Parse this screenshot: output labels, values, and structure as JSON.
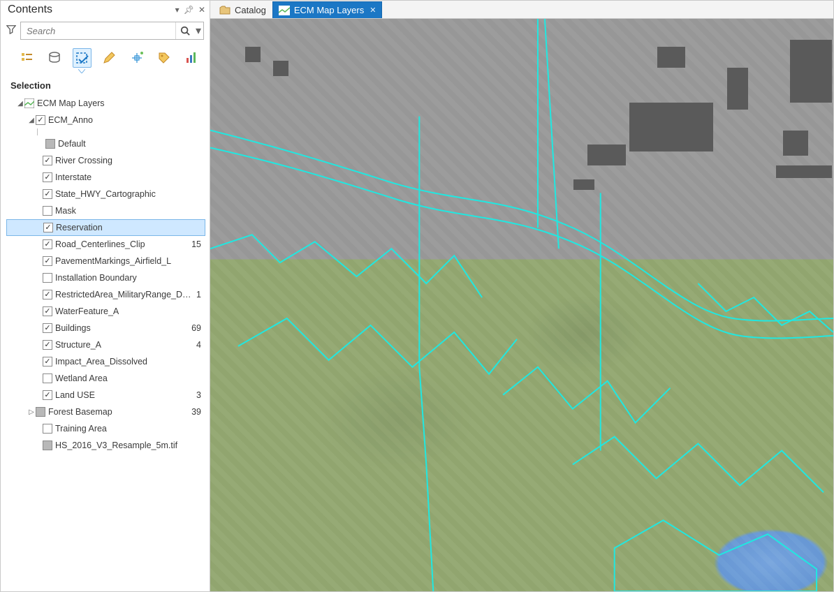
{
  "panel": {
    "title": "Contents"
  },
  "search": {
    "placeholder": "Search"
  },
  "section": {
    "label": "Selection"
  },
  "tabs": {
    "catalog": "Catalog",
    "active": "ECM Map Layers"
  },
  "tree": {
    "root": "ECM Map Layers",
    "anno": "ECM_Anno",
    "default": "Default",
    "layers": [
      {
        "label": "River Crossing",
        "checked": true,
        "count": ""
      },
      {
        "label": "Interstate",
        "checked": true,
        "count": ""
      },
      {
        "label": "State_HWY_Cartographic",
        "checked": true,
        "count": ""
      },
      {
        "label": "Mask",
        "checked": false,
        "count": ""
      },
      {
        "label": "Reservation",
        "checked": true,
        "count": "",
        "selected": true
      },
      {
        "label": "Road_Centerlines_Clip",
        "checked": true,
        "count": "15"
      },
      {
        "label": "PavementMarkings_Airfield_L",
        "checked": true,
        "count": ""
      },
      {
        "label": "Installation Boundary",
        "checked": false,
        "count": ""
      },
      {
        "label": "RestrictedArea_MilitaryRange_Dissolve",
        "checked": true,
        "count": "1"
      },
      {
        "label": "WaterFeature_A",
        "checked": true,
        "count": ""
      },
      {
        "label": "Buildings",
        "checked": true,
        "count": "69"
      },
      {
        "label": "Structure_A",
        "checked": true,
        "count": "4"
      },
      {
        "label": "Impact_Area_Dissolved",
        "checked": true,
        "count": ""
      },
      {
        "label": "Wetland Area",
        "checked": false,
        "count": ""
      },
      {
        "label": "Land USE",
        "checked": true,
        "count": "3"
      }
    ],
    "forest": {
      "label": "Forest Basemap",
      "count": "39"
    },
    "training": {
      "label": "Training Area",
      "checked": false
    },
    "raster": {
      "label": "HS_2016_V3_Resample_5m.tif"
    }
  }
}
